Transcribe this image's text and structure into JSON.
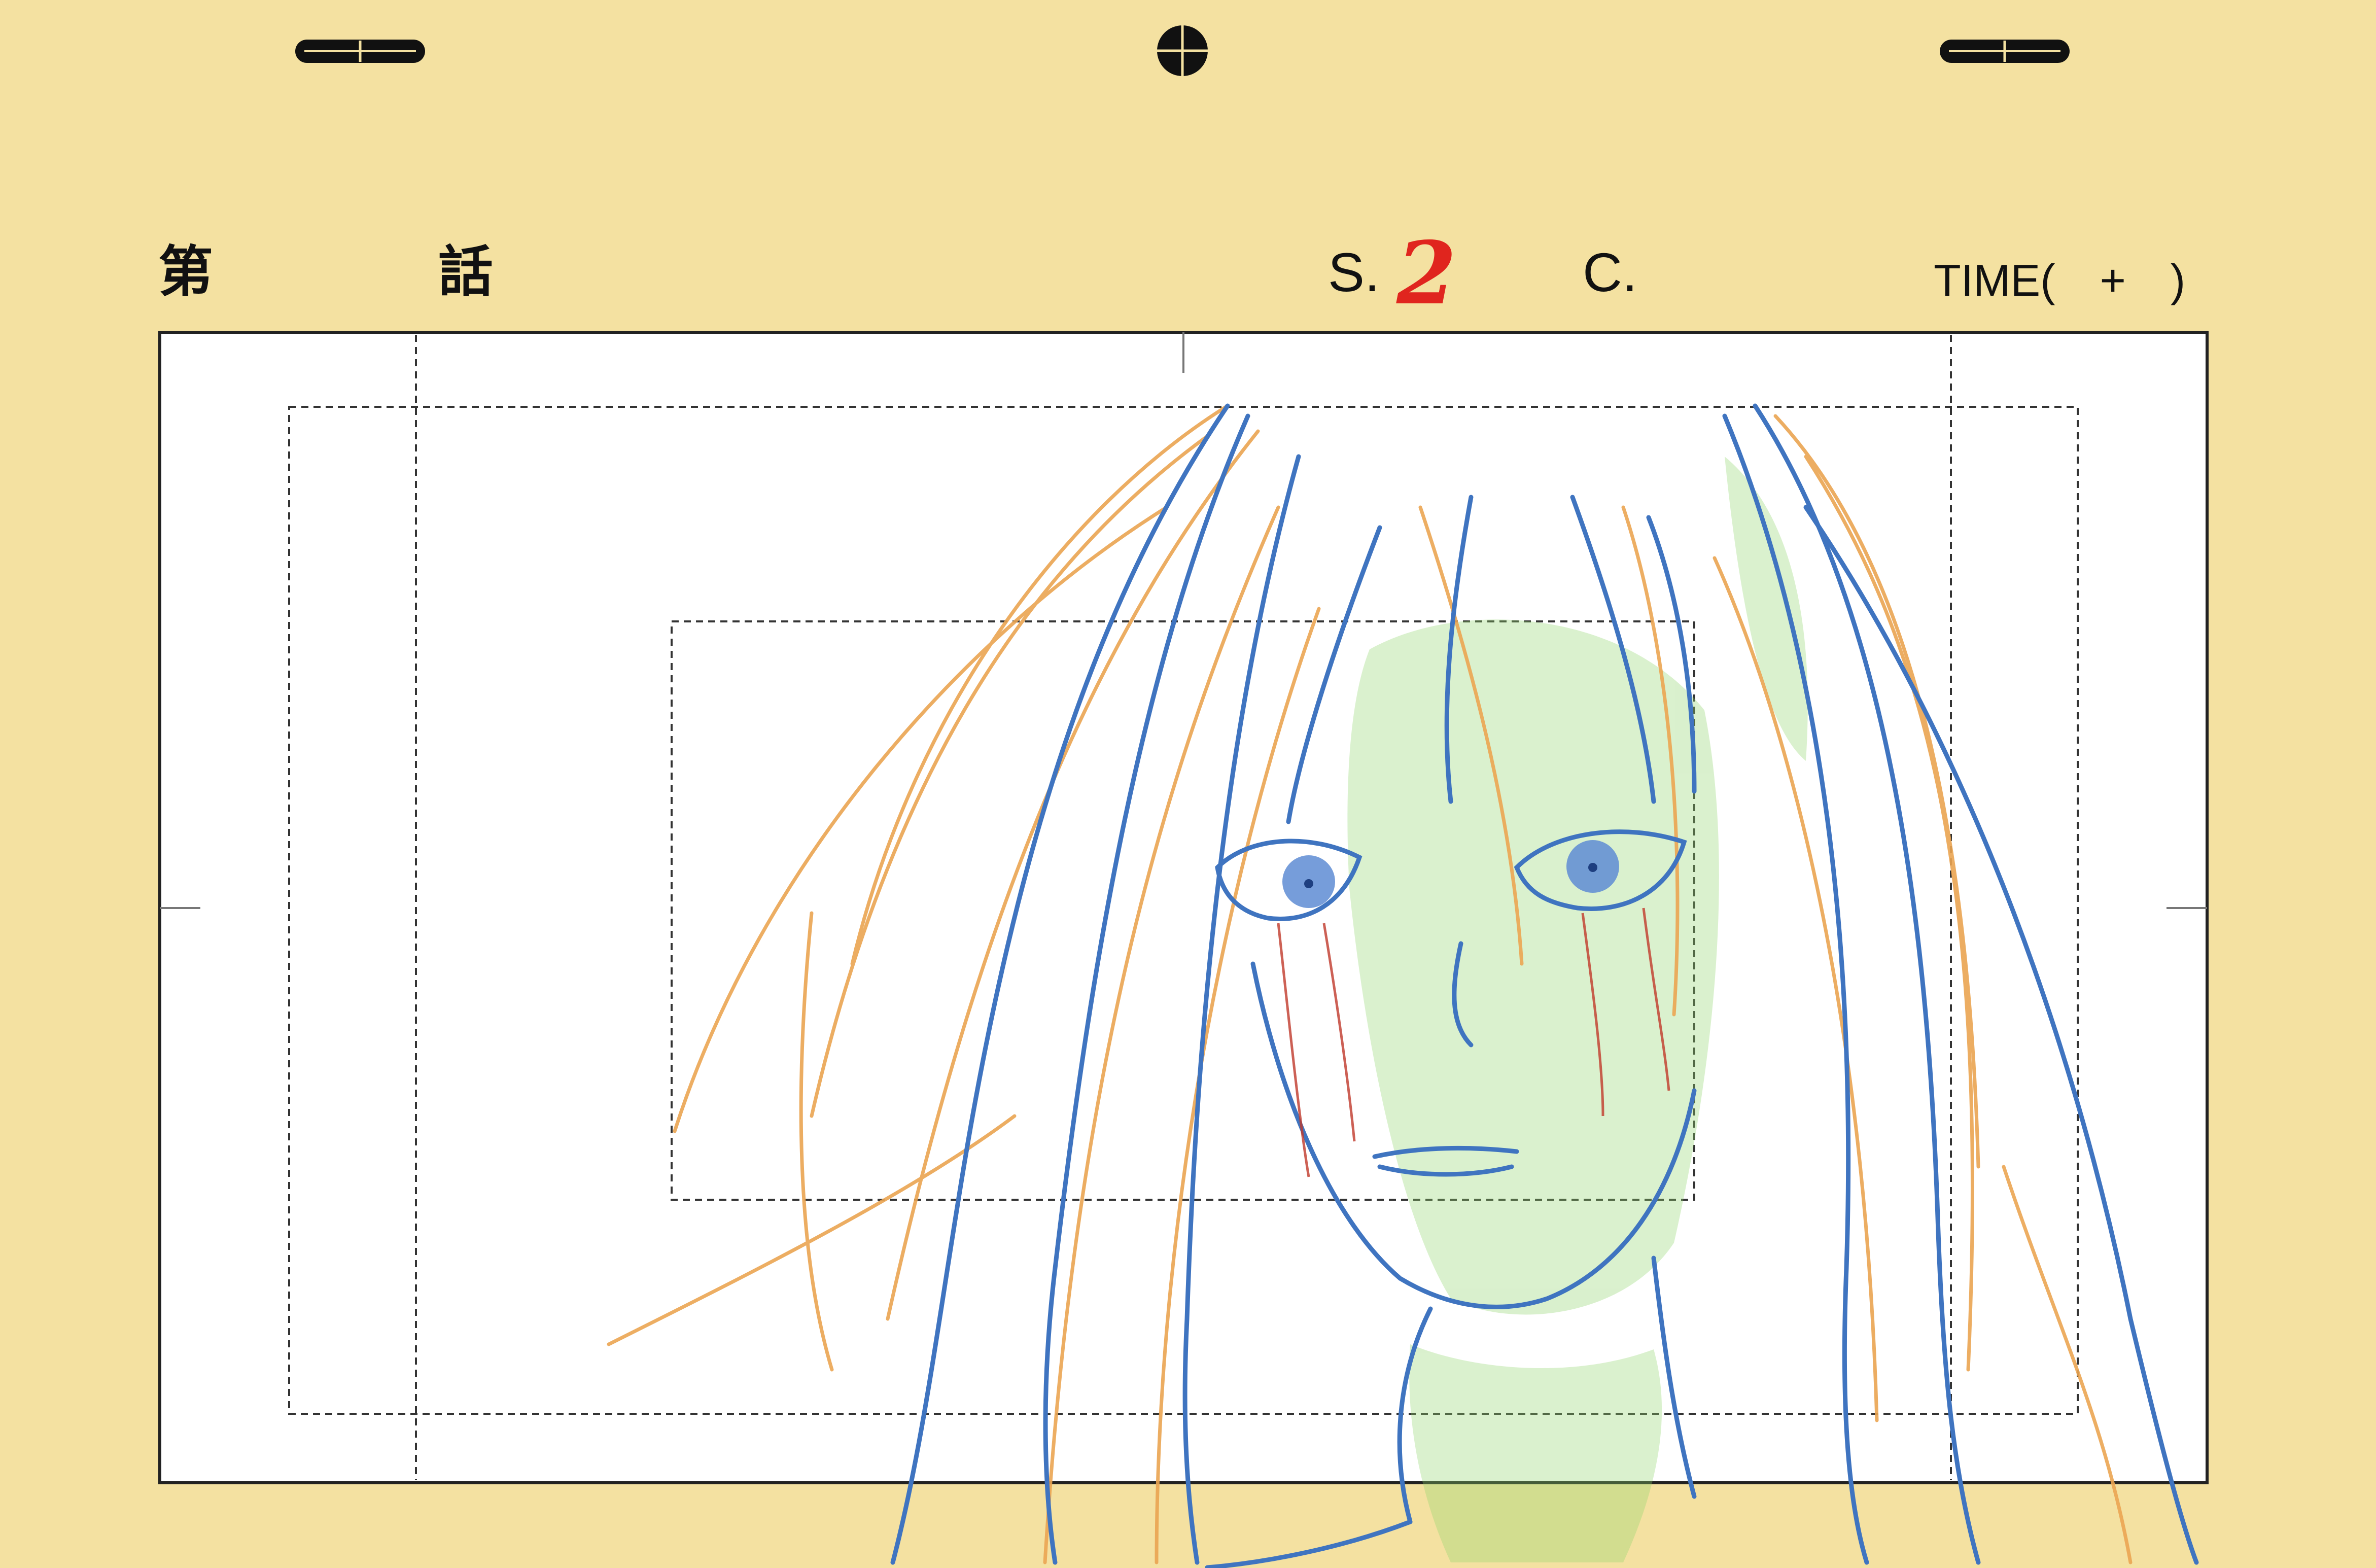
{
  "header": {
    "episode_prefix": "第",
    "episode_suffix": "話",
    "scene_label": "S.",
    "scene_number": "2",
    "cut_label": "C.",
    "time_label": "TIME(　+　)"
  },
  "colors": {
    "paper": "#F4E1A1",
    "frame_fill": "#FFFFFF",
    "frame_stroke": "#222222",
    "guide_dash": "#333333",
    "scene_number_red": "#E0251E",
    "line_blue": "#3F74C0",
    "line_orange": "#EBA552",
    "shade_green": "#8FD46A",
    "tear_red": "#C0392B"
  },
  "icons": {
    "peg_left": "peg-slot-icon",
    "peg_center": "registration-crosshair-icon",
    "peg_right": "peg-slot-icon"
  }
}
